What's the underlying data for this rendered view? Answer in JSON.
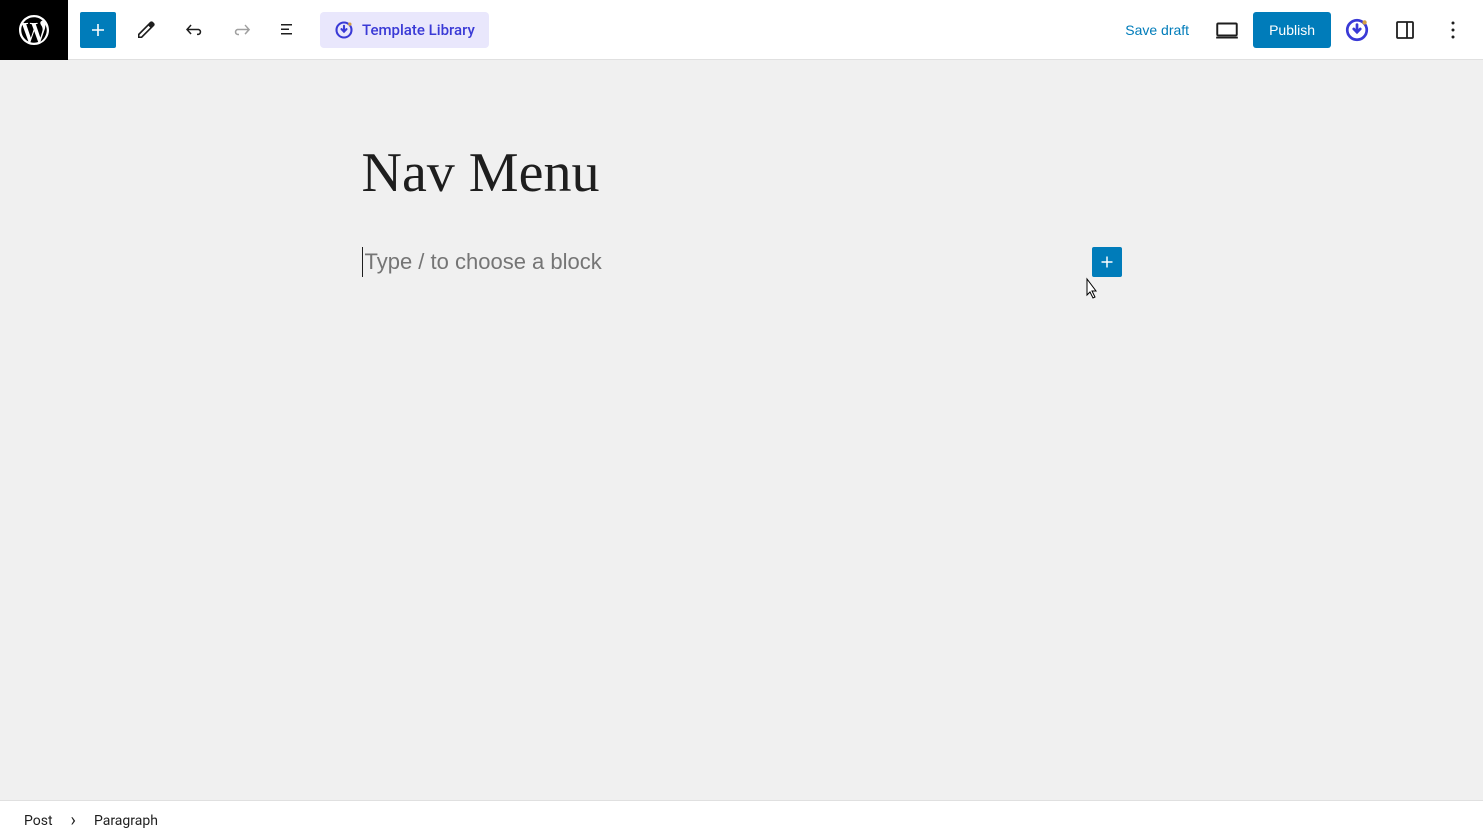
{
  "header": {
    "template_library_label": "Template Library",
    "save_draft_label": "Save draft",
    "publish_label": "Publish"
  },
  "editor": {
    "title": "Nav Menu",
    "block_placeholder": "Type / to choose a block"
  },
  "footer": {
    "crumb_root": "Post",
    "crumb_current": "Paragraph"
  }
}
